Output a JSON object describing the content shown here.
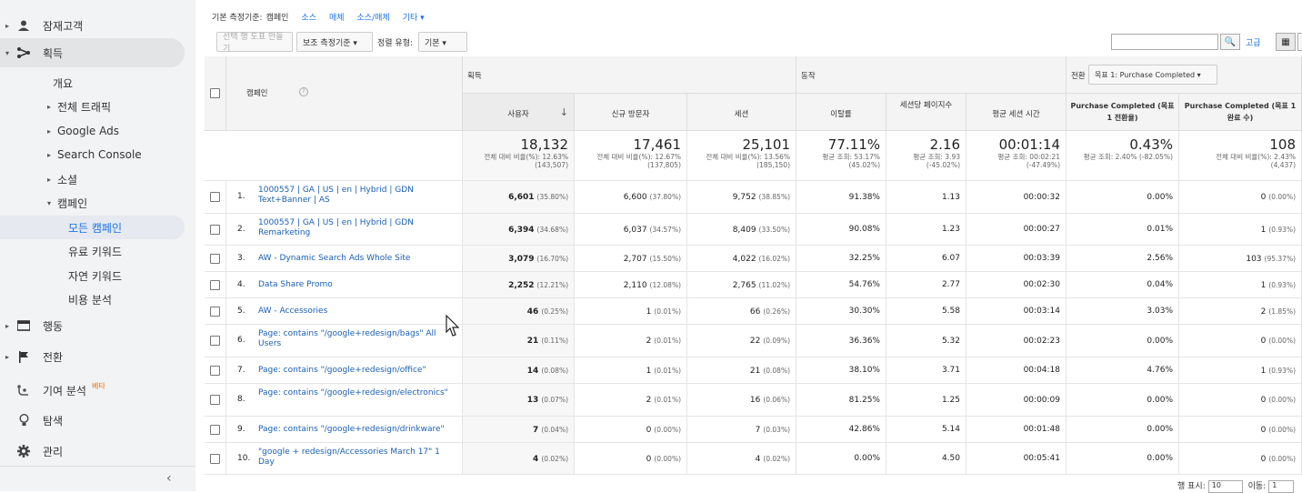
{
  "sidebar": {
    "top_partial": "잠재고객",
    "items": [
      {
        "label": "잠재고객",
        "icon": "person-icon"
      },
      {
        "label": "획득",
        "icon": "acquisition-icon"
      },
      {
        "label": "개요"
      },
      {
        "label": "전체 트래픽"
      },
      {
        "label": "Google Ads"
      },
      {
        "label": "Search Console"
      },
      {
        "label": "소셜"
      },
      {
        "label": "캠페인"
      },
      {
        "label": "모든 캠페인"
      },
      {
        "label": "유료 키워드"
      },
      {
        "label": "자연 키워드"
      },
      {
        "label": "비용 분석"
      },
      {
        "label": "행동",
        "icon": "behavior-icon"
      },
      {
        "label": "전환",
        "icon": "flag-icon"
      },
      {
        "label": "기여 분석",
        "icon": "attribution-icon",
        "badge": "베타"
      },
      {
        "label": "탐색",
        "icon": "lightbulb-icon"
      },
      {
        "label": "관리",
        "icon": "gear-icon"
      }
    ]
  },
  "dimbar": {
    "label": "기본 측정기준:",
    "active": "캠페인",
    "links": [
      "소스",
      "매체",
      "소스/매체"
    ],
    "other": "기타 ▾"
  },
  "toolbar": {
    "create_label": "선택 행 도표 만들기",
    "secondary": "보조 측정기준 ▾",
    "sort_label": "정렬 유형:",
    "sort_value": "기본 ▾",
    "advanced": "고급"
  },
  "table": {
    "groups": {
      "acquisition": "획득",
      "behavior": "동작",
      "conversion": "전환",
      "goal_select": "목표 1: Purchase Completed ▾"
    },
    "headers": {
      "campaign": "캠페인",
      "users": "사용자",
      "new_users": "신규 방문자",
      "sessions": "세션",
      "bounce": "이탈률",
      "pages": "세션당 페이지수",
      "duration": "평균 세션 시간",
      "conv_rate": "Purchase Completed (목표 1 전환율)",
      "completions": "Purchase Completed (목표 1 완료 수)"
    },
    "totals": {
      "users": {
        "v": "18,132",
        "s1": "전체 대비 비율(%): 12.63%",
        "s2": "(143,507)"
      },
      "new_users": {
        "v": "17,461",
        "s1": "전체 대비 비율(%): 12.67%",
        "s2": "(137,805)"
      },
      "sessions": {
        "v": "25,101",
        "s1": "전체 대비 비율(%): 13.56%",
        "s2": "(185,150)"
      },
      "bounce": {
        "v": "77.11%",
        "s1": "평균 조회: 53.17%",
        "s2": "(45.02%)"
      },
      "pages": {
        "v": "2.16",
        "s1": "평균 조회: 3.93",
        "s2": "(-45.02%)"
      },
      "duration": {
        "v": "00:01:14",
        "s1": "평균 조회: 00:02:21",
        "s2": "(-47.49%)"
      },
      "conv_rate": {
        "v": "0.43%",
        "s1": "평균 조회: 2.40% (-82.05%)",
        "s2": ""
      },
      "completions": {
        "v": "108",
        "s1": "전체 대비 비율(%): 2.43%",
        "s2": "(4,437)"
      }
    },
    "rows": [
      {
        "n": "1.",
        "name": "1000557 | GA | US | en | Hybrid | GDN Text+Banner | AS",
        "u": "6,601",
        "up": "(35.80%)",
        "nu": "6,600",
        "nup": "(37.80%)",
        "s": "9,752",
        "sp": "(38.85%)",
        "b": "91.38%",
        "p": "1.13",
        "d": "00:00:32",
        "cr": "0.00%",
        "c": "0",
        "cp": "(0.00%)"
      },
      {
        "n": "2.",
        "name": "1000557 | GA | US | en | Hybrid | GDN Remarketing",
        "u": "6,394",
        "up": "(34.68%)",
        "nu": "6,037",
        "nup": "(34.57%)",
        "s": "8,409",
        "sp": "(33.50%)",
        "b": "90.08%",
        "p": "1.23",
        "d": "00:00:27",
        "cr": "0.01%",
        "c": "1",
        "cp": "(0.93%)"
      },
      {
        "n": "3.",
        "name": "AW - Dynamic Search Ads Whole Site",
        "u": "3,079",
        "up": "(16.70%)",
        "nu": "2,707",
        "nup": "(15.50%)",
        "s": "4,022",
        "sp": "(16.02%)",
        "b": "32.25%",
        "p": "6.07",
        "d": "00:03:39",
        "cr": "2.56%",
        "c": "103",
        "cp": "(95.37%)"
      },
      {
        "n": "4.",
        "name": "Data Share Promo",
        "u": "2,252",
        "up": "(12.21%)",
        "nu": "2,110",
        "nup": "(12.08%)",
        "s": "2,765",
        "sp": "(11.02%)",
        "b": "54.76%",
        "p": "2.77",
        "d": "00:02:30",
        "cr": "0.04%",
        "c": "1",
        "cp": "(0.93%)"
      },
      {
        "n": "5.",
        "name": "AW - Accessories",
        "u": "46",
        "up": "(0.25%)",
        "nu": "1",
        "nup": "(0.01%)",
        "s": "66",
        "sp": "(0.26%)",
        "b": "30.30%",
        "p": "5.58",
        "d": "00:03:14",
        "cr": "3.03%",
        "c": "2",
        "cp": "(1.85%)"
      },
      {
        "n": "6.",
        "name": "Page: contains \"/google+redesign/bags\" All Users",
        "u": "21",
        "up": "(0.11%)",
        "nu": "2",
        "nup": "(0.01%)",
        "s": "22",
        "sp": "(0.09%)",
        "b": "36.36%",
        "p": "5.32",
        "d": "00:02:23",
        "cr": "0.00%",
        "c": "0",
        "cp": "(0.00%)"
      },
      {
        "n": "7.",
        "name": "Page: contains \"/google+redesign/office\"",
        "u": "14",
        "up": "(0.08%)",
        "nu": "1",
        "nup": "(0.01%)",
        "s": "21",
        "sp": "(0.08%)",
        "b": "38.10%",
        "p": "3.71",
        "d": "00:04:18",
        "cr": "4.76%",
        "c": "1",
        "cp": "(0.93%)"
      },
      {
        "n": "8.",
        "name": "Page: contains \"/google+redesign/electronics\"",
        "u": "13",
        "up": "(0.07%)",
        "nu": "2",
        "nup": "(0.01%)",
        "s": "16",
        "sp": "(0.06%)",
        "b": "81.25%",
        "p": "1.25",
        "d": "00:00:09",
        "cr": "0.00%",
        "c": "0",
        "cp": "(0.00%)"
      },
      {
        "n": "9.",
        "name": "Page: contains \"/google+redesign/drinkware\"",
        "u": "7",
        "up": "(0.04%)",
        "nu": "0",
        "nup": "(0.00%)",
        "s": "7",
        "sp": "(0.03%)",
        "b": "42.86%",
        "p": "5.14",
        "d": "00:01:48",
        "cr": "0.00%",
        "c": "0",
        "cp": "(0.00%)"
      },
      {
        "n": "10.",
        "name": "\"google + redesign/Accessories March 17\" 1 Day",
        "u": "4",
        "up": "(0.02%)",
        "nu": "0",
        "nup": "(0.00%)",
        "s": "4",
        "sp": "(0.02%)",
        "b": "0.00%",
        "p": "4.50",
        "d": "00:05:41",
        "cr": "0.00%",
        "c": "0",
        "cp": "(0.00%)"
      }
    ]
  },
  "pager": {
    "show_label": "행 표시:",
    "show_value": "10",
    "goto_label": "이동:",
    "goto_value": "1"
  }
}
